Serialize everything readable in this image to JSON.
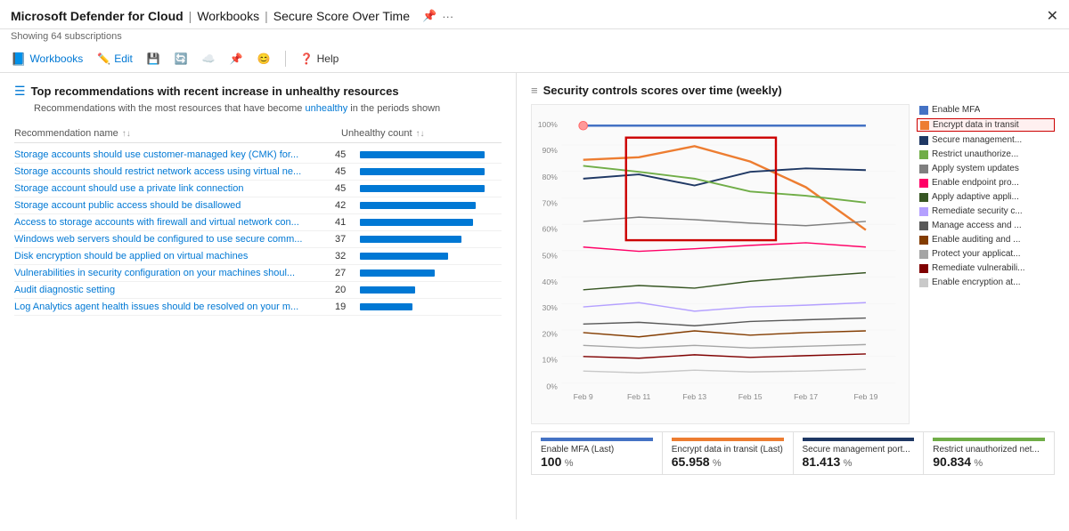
{
  "titleBar": {
    "appName": "Microsoft Defender for Cloud",
    "divider1": "|",
    "section": "Workbooks",
    "divider2": "|",
    "pageName": "Secure Score Over Time",
    "subtitle": "Showing 64 subscriptions"
  },
  "toolbar": {
    "items": [
      {
        "id": "workbooks",
        "label": "Workbooks",
        "icon": "📘"
      },
      {
        "id": "edit",
        "label": "Edit",
        "icon": "✏️"
      },
      {
        "id": "save",
        "label": "",
        "icon": "💾"
      },
      {
        "id": "refresh",
        "label": "",
        "icon": "🔄"
      },
      {
        "id": "cloud",
        "label": "",
        "icon": "☁️"
      },
      {
        "id": "pin",
        "label": "",
        "icon": "📌"
      },
      {
        "id": "emoji",
        "label": "",
        "icon": "😊"
      },
      {
        "id": "help",
        "label": "Help",
        "icon": "❓"
      }
    ]
  },
  "leftPanel": {
    "sectionTitle": "Top recommendations with recent increase in unhealthy resources",
    "sectionDesc": "Recommendations with the most resources that have become unhealthy in the periods shown",
    "unhealthyWord": "unhealthy",
    "tableHeader": {
      "colName": "Recommendation name",
      "colCount": "Unhealthy count"
    },
    "rows": [
      {
        "name": "Storage accounts should use customer-managed key (CMK) for...",
        "count": 45,
        "barWidth": 140
      },
      {
        "name": "Storage accounts should restrict network access using virtual ne...",
        "count": 45,
        "barWidth": 140
      },
      {
        "name": "Storage account should use a private link connection",
        "count": 45,
        "barWidth": 140
      },
      {
        "name": "Storage account public access should be disallowed",
        "count": 42,
        "barWidth": 130
      },
      {
        "name": "Access to storage accounts with firewall and virtual network con...",
        "count": 41,
        "barWidth": 127
      },
      {
        "name": "Windows web servers should be configured to use secure comm...",
        "count": 37,
        "barWidth": 114
      },
      {
        "name": "Disk encryption should be applied on virtual machines",
        "count": 32,
        "barWidth": 99
      },
      {
        "name": "Vulnerabilities in security configuration on your machines shoul...",
        "count": 27,
        "barWidth": 84
      },
      {
        "name": "Audit diagnostic setting",
        "count": 20,
        "barWidth": 62
      },
      {
        "name": "Log Analytics agent health issues should be resolved on your m...",
        "count": 19,
        "barWidth": 59
      }
    ]
  },
  "rightPanel": {
    "sectionTitle": "Security controls scores over time (weekly)",
    "chartIcon": "≡",
    "yAxisLabels": [
      "100%",
      "90%",
      "80%",
      "70%",
      "60%",
      "50%",
      "40%",
      "30%",
      "20%",
      "10%",
      "0%"
    ],
    "xAxisLabels": [
      "Feb 9",
      "Feb 11",
      "Feb 13",
      "Feb 15",
      "Feb 17",
      "Feb 19"
    ],
    "legend": [
      {
        "label": "Enable MFA",
        "color": "#4472c4",
        "highlighted": false
      },
      {
        "label": "Encrypt data in transit",
        "color": "#ed7d31",
        "highlighted": true
      },
      {
        "label": "Secure management...",
        "color": "#1f3864",
        "highlighted": false
      },
      {
        "label": "Restrict unauthorize...",
        "color": "#70ad47",
        "highlighted": false
      },
      {
        "label": "Apply system updates",
        "color": "#7f7f7f",
        "highlighted": false
      },
      {
        "label": "Enable endpoint pro...",
        "color": "#ff0066",
        "highlighted": false
      },
      {
        "label": "Apply adaptive appli...",
        "color": "#375623",
        "highlighted": false
      },
      {
        "label": "Remediate security c...",
        "color": "#b4a0ff",
        "highlighted": false
      },
      {
        "label": "Manage access and ...",
        "color": "#595959",
        "highlighted": false
      },
      {
        "label": "Enable auditing and ...",
        "color": "#833c00",
        "highlighted": false
      },
      {
        "label": "Protect your applicat...",
        "color": "#a5a5a5",
        "highlighted": false
      },
      {
        "label": "Remediate vulnerabili...",
        "color": "#7f0000",
        "highlighted": false
      },
      {
        "label": "Enable encryption at...",
        "color": "#c9c9c9",
        "highlighted": false
      }
    ],
    "bottomMetrics": [
      {
        "label": "Enable MFA (Last)",
        "value": "100",
        "unit": "%",
        "color": "#4472c4"
      },
      {
        "label": "Encrypt data in transit (Last)",
        "value": "65.958",
        "unit": "%",
        "color": "#ed7d31"
      },
      {
        "label": "Secure management port...",
        "value": "81.413",
        "unit": "%",
        "color": "#1f3864"
      },
      {
        "label": "Restrict unauthorized net...",
        "value": "90.834",
        "unit": "%",
        "color": "#70ad47"
      }
    ]
  }
}
